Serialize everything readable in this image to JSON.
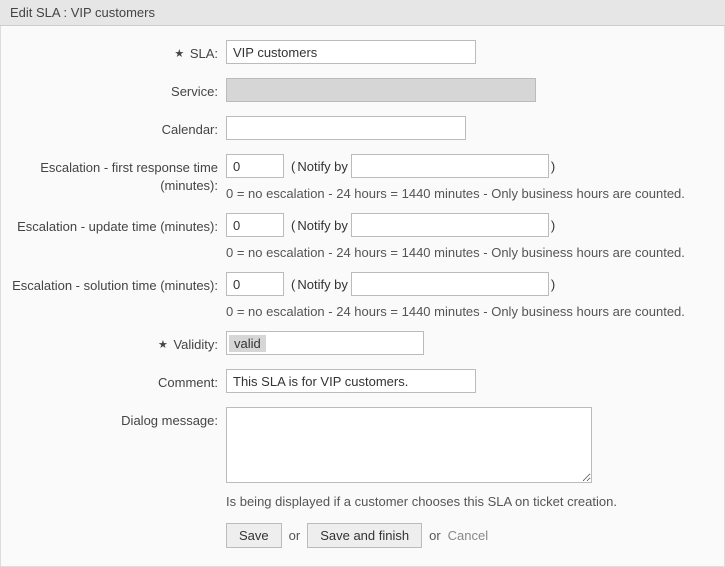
{
  "header": {
    "title": "Edit SLA : VIP customers"
  },
  "labels": {
    "sla": "SLA:",
    "service": "Service:",
    "calendar": "Calendar:",
    "escalation_first": "Escalation - first response time (minutes):",
    "escalation_update": "Escalation - update time (minutes):",
    "escalation_solution": "Escalation - solution time (minutes):",
    "validity": "Validity:",
    "comment": "Comment:",
    "dialog_message": "Dialog message:",
    "notify_by": "Notify by"
  },
  "values": {
    "sla": "VIP customers",
    "service": "",
    "calendar": "",
    "first_response": "0",
    "first_response_notify": "",
    "update_time": "0",
    "update_time_notify": "",
    "solution_time": "0",
    "solution_time_notify": "",
    "validity": "valid",
    "comment": "This SLA is for VIP customers.",
    "dialog_message": ""
  },
  "hints": {
    "escalation": "0 = no escalation - 24 hours = 1440 minutes - Only business hours are counted.",
    "dialog_message": "Is being displayed if a customer chooses this SLA on ticket creation."
  },
  "buttons": {
    "save": "Save",
    "or1": "or",
    "save_finish": "Save and finish",
    "or2": "or",
    "cancel": "Cancel"
  },
  "glyph": {
    "required": "★",
    "paren_open": "(",
    "paren_close": ")"
  }
}
